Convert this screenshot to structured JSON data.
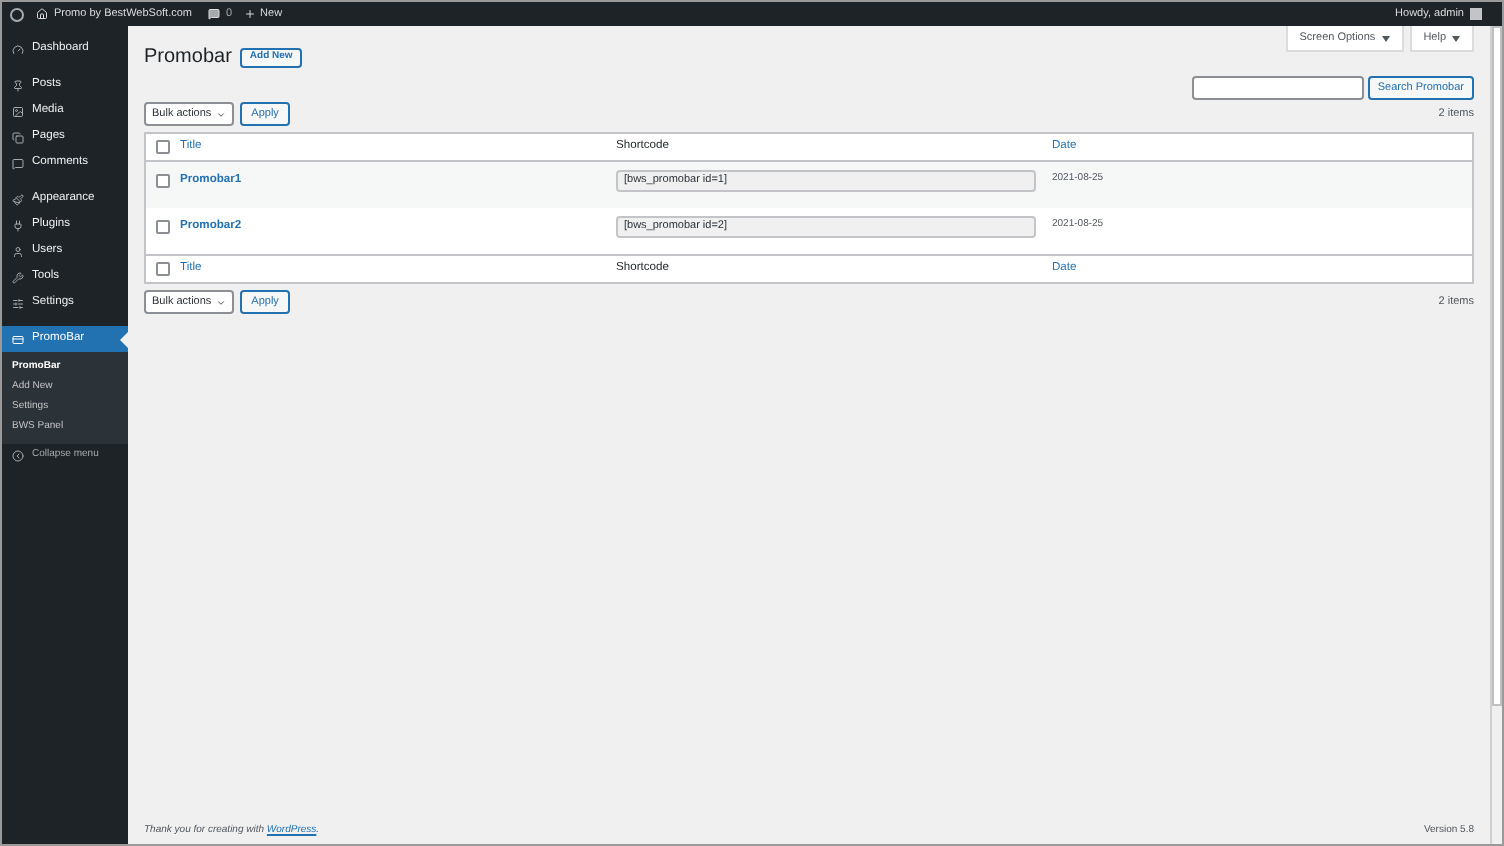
{
  "admin_bar": {
    "site": "Promo by BestWebSoft.com",
    "comments": "0",
    "new": "New",
    "greeting": "Howdy, admin"
  },
  "sidebar": {
    "groups": [
      [
        {
          "label": "Dashboard",
          "selected": false
        }
      ],
      [
        {
          "label": "Posts",
          "selected": false
        },
        {
          "label": "Media",
          "selected": false
        },
        {
          "label": "Pages",
          "selected": false
        },
        {
          "label": "Comments",
          "selected": false
        }
      ],
      [
        {
          "label": "Appearance",
          "selected": false
        },
        {
          "label": "Plugins",
          "selected": false
        },
        {
          "label": "Users",
          "selected": false
        },
        {
          "label": "Tools",
          "selected": false
        },
        {
          "label": "Settings",
          "selected": false
        }
      ],
      [
        {
          "label": "PromoBar",
          "selected": true
        }
      ]
    ],
    "submenu": [
      {
        "label": "PromoBar",
        "selected": true
      },
      {
        "label": "Add New",
        "selected": false
      },
      {
        "label": "Settings",
        "selected": false
      },
      {
        "label": "BWS Panel",
        "selected": false
      }
    ],
    "collapse": "Collapse menu"
  },
  "header": {
    "title": "Promobar",
    "add_new": "Add New",
    "screen_options": "Screen Options",
    "help": "Help"
  },
  "search": {
    "button": "Search Promobar"
  },
  "top_nav": {
    "bulk": "Bulk actions",
    "apply": "Apply",
    "count": "2 items"
  },
  "table": {
    "select_all_top": false,
    "select_all_bottom": false,
    "columns": [
      "Title",
      "Shortcode",
      "Date"
    ],
    "footer_columns": [
      "Title",
      "Shortcode",
      "Date"
    ],
    "rows": [
      {
        "title": "Promobar1",
        "shortcode": "[bws_promobar id=1]",
        "date": "2021-08-25",
        "checked": false
      },
      {
        "title": "Promobar2",
        "shortcode": "[bws_promobar id=2]",
        "date": "2021-08-25",
        "checked": false
      }
    ]
  },
  "bottom_nav": {
    "bulk": "Bulk actions",
    "apply": "Apply",
    "count": "2 items"
  },
  "footer": {
    "thanks": "Thank you for creating with ",
    "link": "WordPress",
    "period": ".",
    "version": "Version 5.8"
  }
}
